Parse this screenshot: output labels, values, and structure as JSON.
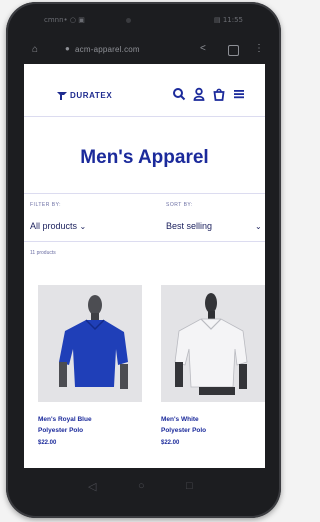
{
  "status_bar": {
    "left": "cmnn• ○ ▣",
    "right": "▤ 11:55"
  },
  "browser": {
    "url": "acm-apparel.com"
  },
  "site": {
    "brand": "DURATEX",
    "page_title": "Men's Apparel"
  },
  "filters": {
    "filter_label": "FILTER BY:",
    "filter_value": "All products",
    "sort_label": "SORT BY:",
    "sort_value": "Best selling",
    "product_count": "11 products"
  },
  "products": [
    {
      "name_line1": "Men's Royal Blue",
      "name_line2": "Polyester Polo",
      "price": "$22.00",
      "shirt_color": "#1f3fb8"
    },
    {
      "name_line1": "Men's White",
      "name_line2": "Polyester Polo",
      "price": "$22.00",
      "shirt_color": "#f4f4f6"
    }
  ],
  "colors": {
    "brand": "#1b2a9b",
    "accent_text": "#1a1f5c"
  },
  "icons": [
    "home-icon",
    "lock-icon",
    "share-icon",
    "tabs-icon",
    "more-menu-icon",
    "search-icon",
    "account-icon",
    "cart-icon",
    "hamburger-menu-icon",
    "back-icon",
    "home-circle-icon",
    "recents-icon"
  ]
}
